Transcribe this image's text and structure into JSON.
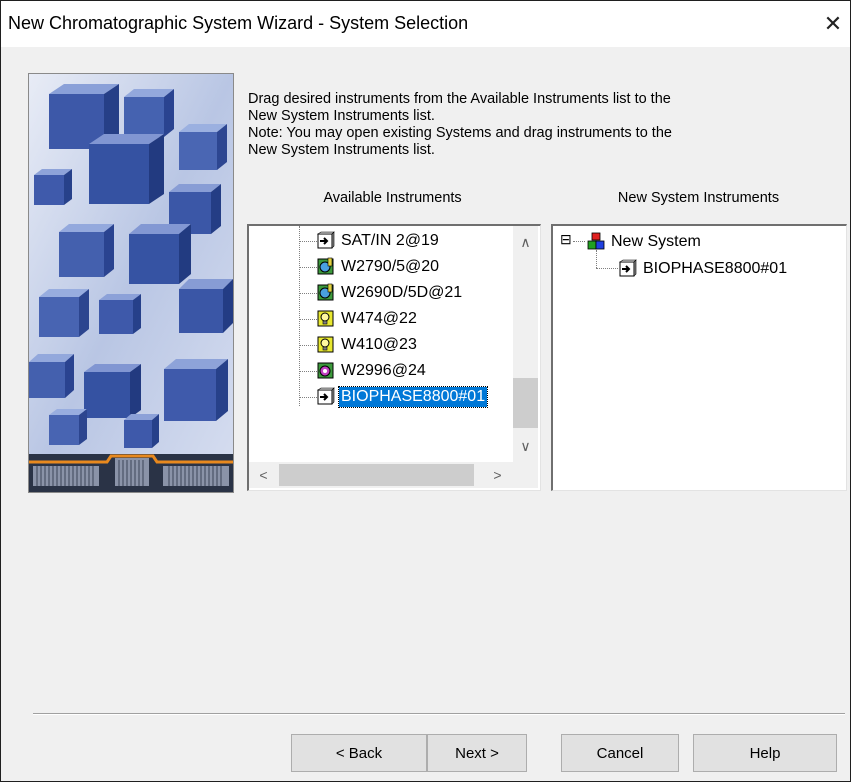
{
  "window": {
    "title": "New Chromatographic System Wizard - System Selection",
    "close_glyph": "✕"
  },
  "instructions": {
    "line1": "Drag desired instruments from the Available Instruments list to the",
    "line2": "New System Instruments list.",
    "line3": "Note:  You may open existing Systems and drag instruments to the",
    "line4": "New System Instruments list."
  },
  "available": {
    "label": "Available Instruments",
    "items": [
      {
        "label": "SAT/IN 2@19",
        "icon": "detector-arrow-icon"
      },
      {
        "label": "W2790/5@20",
        "icon": "separations-module-icon"
      },
      {
        "label": "W2690D/5D@21",
        "icon": "separations-module-icon"
      },
      {
        "label": "W474@22",
        "icon": "lamp-detector-icon"
      },
      {
        "label": "W410@23",
        "icon": "lamp-detector-icon"
      },
      {
        "label": "W2996@24",
        "icon": "pda-detector-icon"
      },
      {
        "label": "BIOPHASE8800#01",
        "icon": "detector-arrow-icon",
        "selected": true
      }
    ],
    "scroll_up": "∧",
    "scroll_down": "∨",
    "scroll_left": "<",
    "scroll_right": ">"
  },
  "new_system": {
    "label": "New System Instruments",
    "root": {
      "label": "New System",
      "expander": "⊟",
      "icon": "system-blocks-icon"
    },
    "children": [
      {
        "label": "BIOPHASE8800#01",
        "icon": "detector-arrow-icon"
      }
    ]
  },
  "buttons": {
    "back": "< Back",
    "next": "Next >",
    "cancel": "Cancel",
    "help": "Help"
  },
  "colors": {
    "selection": "#0078d7",
    "dialog_bg": "#f0f0f0"
  }
}
